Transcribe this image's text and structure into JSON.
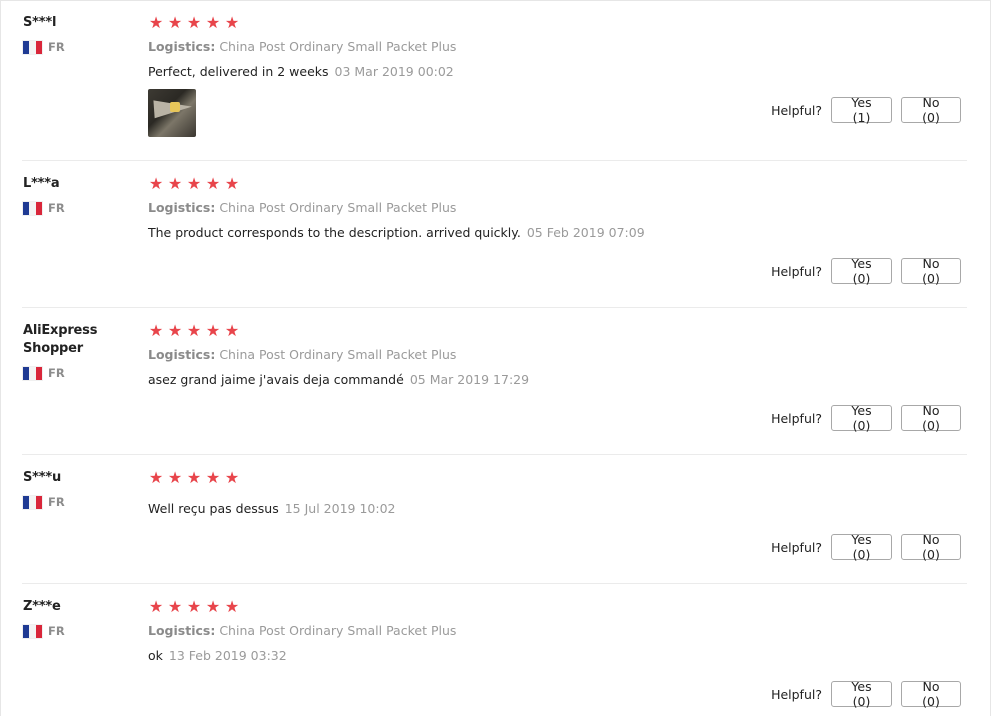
{
  "colors": {
    "star": "#e8454b",
    "muted_text": "#9a9a9a",
    "border": "#a8a8a8"
  },
  "labels": {
    "logistics_prefix": "Logistics:",
    "helpful": "Helpful?"
  },
  "reviews": [
    {
      "user": "S***l",
      "country": "FR",
      "rating": 5,
      "logistics": "China Post Ordinary Small Packet Plus",
      "text": "Perfect, delivered in 2 weeks",
      "date": "03 Mar 2019 00:02",
      "has_photo": true,
      "yes": "Yes (1)",
      "no": "No (0)"
    },
    {
      "user": "L***a",
      "country": "FR",
      "rating": 5,
      "logistics": "China Post Ordinary Small Packet Plus",
      "text": "The product corresponds to the description. arrived quickly.",
      "date": "05 Feb 2019 07:09",
      "has_photo": false,
      "yes": "Yes (0)",
      "no": "No (0)"
    },
    {
      "user": "AliExpress Shopper",
      "country": "FR",
      "rating": 5,
      "logistics": "China Post Ordinary Small Packet Plus",
      "text": "asez grand jaime j'avais deja commandé",
      "date": "05 Mar 2019 17:29",
      "has_photo": false,
      "yes": "Yes (0)",
      "no": "No (0)"
    },
    {
      "user": "S***u",
      "country": "FR",
      "rating": 5,
      "logistics": "",
      "text": "Well reçu pas dessus",
      "date": "15 Jul 2019 10:02",
      "has_photo": false,
      "yes": "Yes (0)",
      "no": "No (0)"
    },
    {
      "user": "Z***e",
      "country": "FR",
      "rating": 5,
      "logistics": "China Post Ordinary Small Packet Plus",
      "text": "ok",
      "date": "13 Feb 2019 03:32",
      "has_photo": false,
      "yes": "Yes (0)",
      "no": "No (0)"
    }
  ]
}
